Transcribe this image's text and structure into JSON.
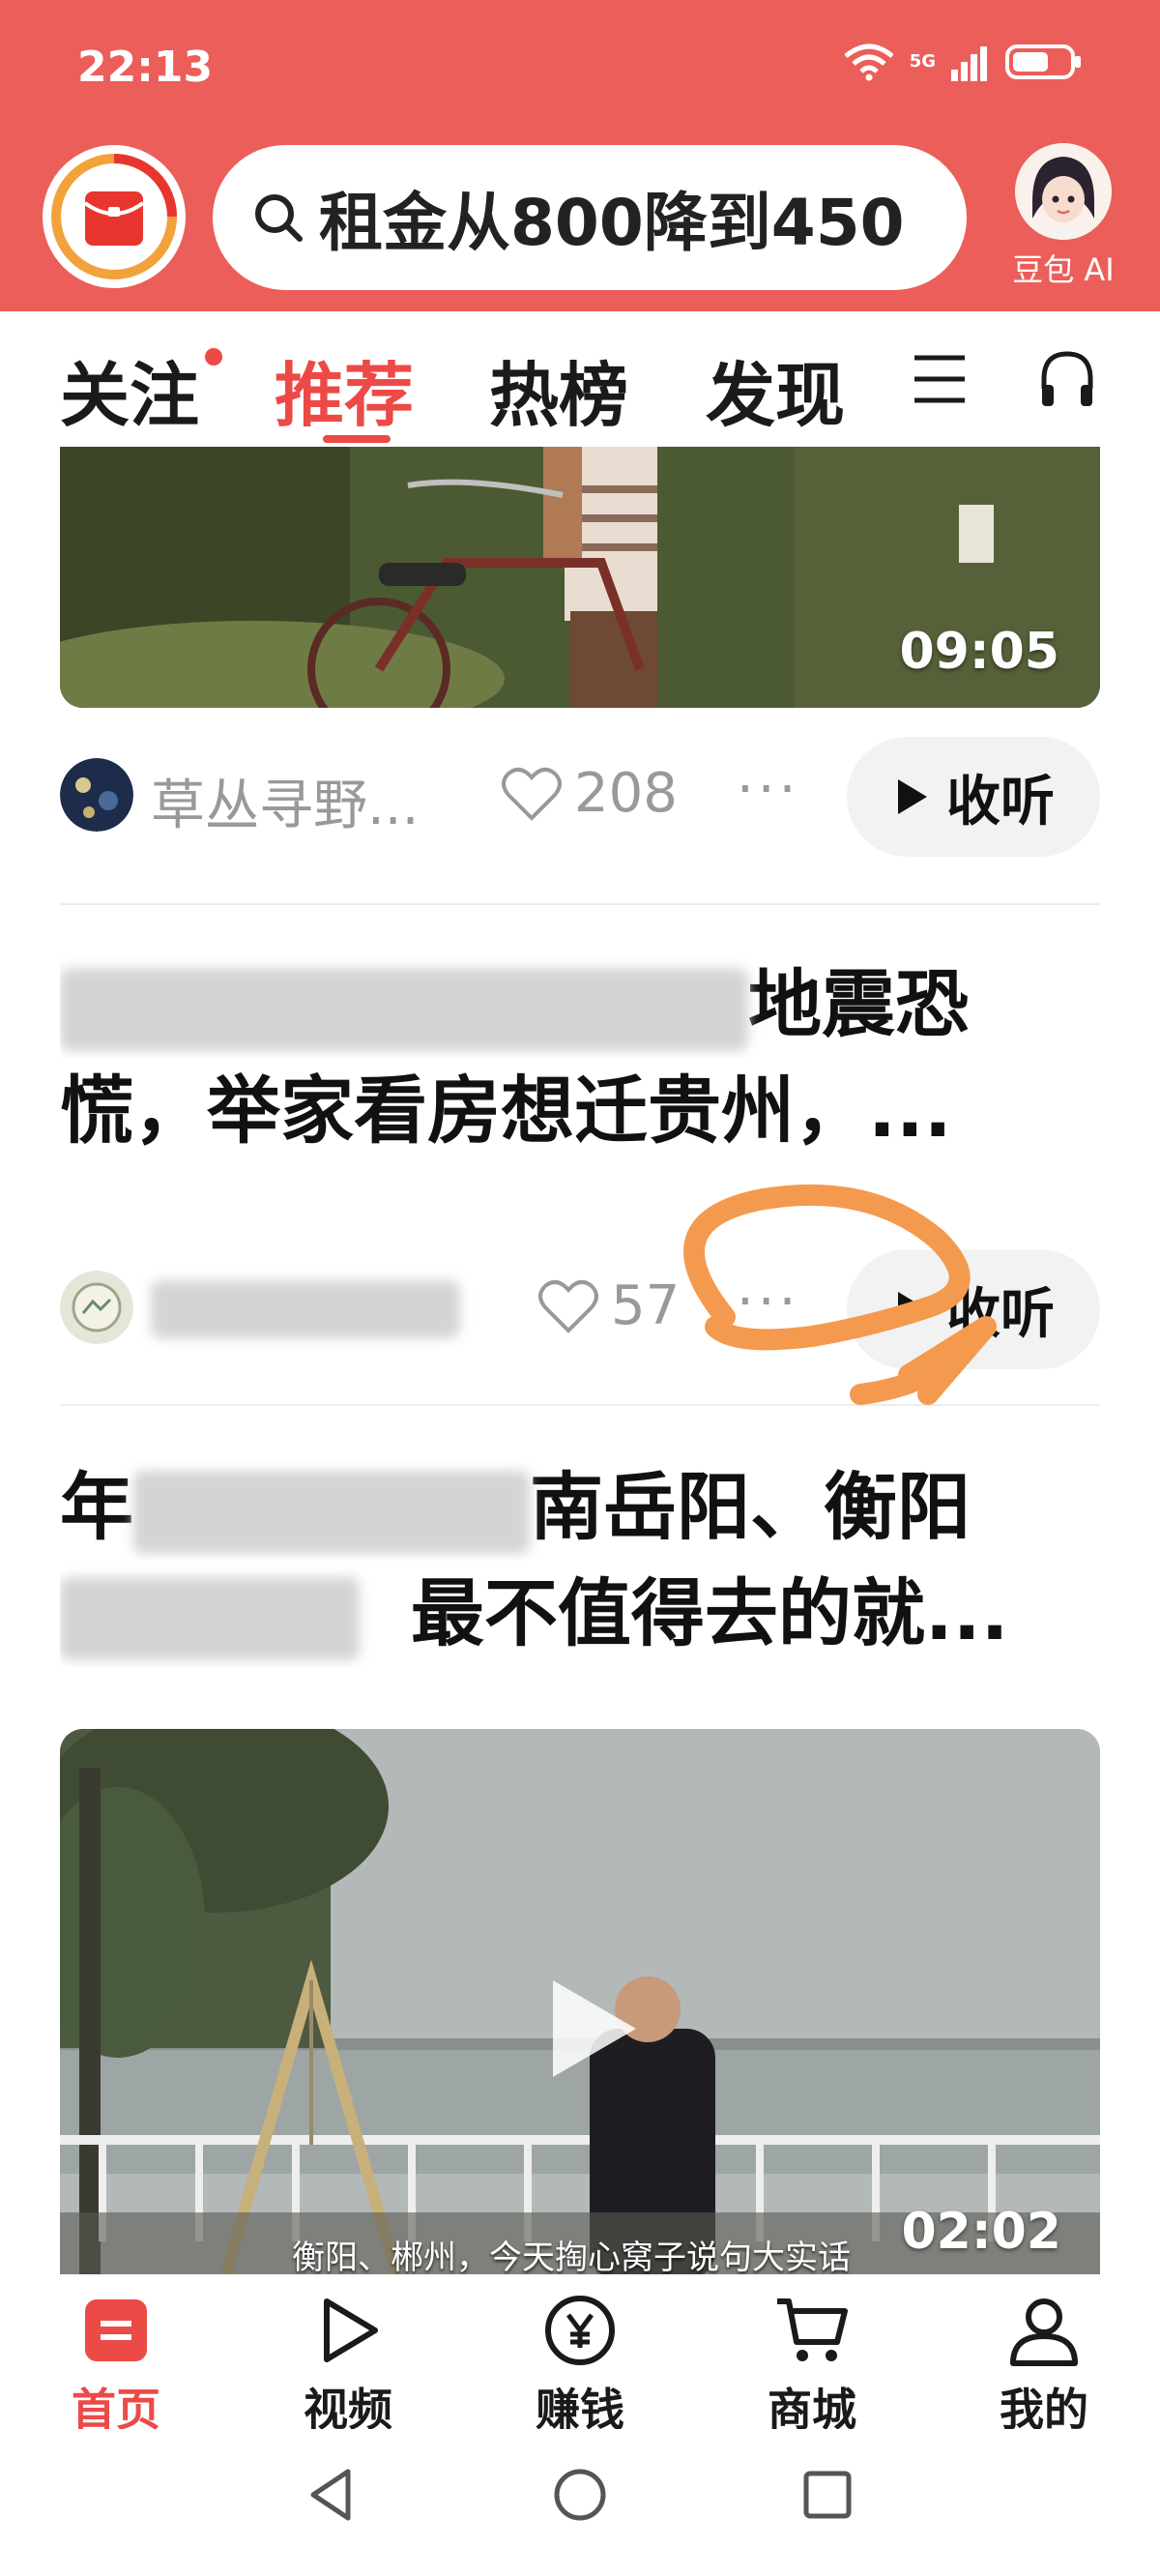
{
  "status_bar": {
    "time": "22:13",
    "network": "5G"
  },
  "header": {
    "search_text": "租金从800降到450",
    "ai_label": "豆包 AI"
  },
  "tabs": [
    {
      "label": "关注"
    },
    {
      "label": "推荐"
    },
    {
      "label": "热榜"
    },
    {
      "label": "发现"
    }
  ],
  "feed": {
    "item1": {
      "duration": "09:05",
      "author": "草丛寻野...",
      "likes": "208",
      "listen_label": "收听"
    },
    "item2": {
      "title_line1_visible": "地震恐",
      "title_line2": "慌，举家看房想迁贵州，...",
      "likes": "57",
      "listen_label": "收听"
    },
    "item3": {
      "title_line1_visible": "南岳阳、衡阳",
      "title_line2_visible": "最不值得去的就...",
      "duration": "02:02",
      "subtitle": "衡阳、郴州，今天掏心窝子说句大实话"
    }
  },
  "bottom_nav": [
    {
      "label": "首页",
      "icon": "home-icon",
      "active": true
    },
    {
      "label": "视频",
      "icon": "video-play-icon",
      "active": false
    },
    {
      "label": "赚钱",
      "icon": "yuan-coin-icon",
      "active": false
    },
    {
      "label": "商城",
      "icon": "cart-icon",
      "active": false
    },
    {
      "label": "我的",
      "icon": "profile-icon",
      "active": false
    }
  ],
  "colors": {
    "brand_red": "#ec5e5a",
    "accent_red": "#ec4a47",
    "annotation_orange": "#f39a4e"
  }
}
